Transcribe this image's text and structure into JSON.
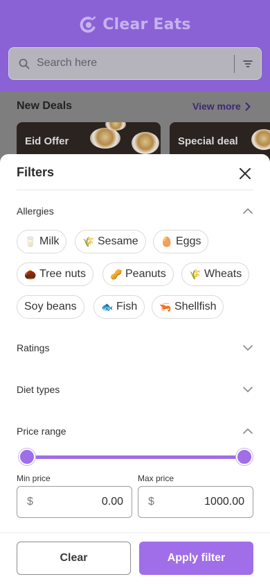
{
  "app": {
    "name": "Clear Eats"
  },
  "search": {
    "placeholder": "Search here"
  },
  "deals": {
    "title": "New Deals",
    "view_more": "View more",
    "cards": [
      {
        "label": "Eid Offer"
      },
      {
        "label": "Special deal"
      }
    ]
  },
  "filters": {
    "title": "Filters",
    "sections": {
      "allergies": {
        "label": "Allergies",
        "expanded": true
      },
      "ratings": {
        "label": "Ratings",
        "expanded": false
      },
      "diet_types": {
        "label": "Diet types",
        "expanded": false
      },
      "price_range": {
        "label": "Price range",
        "expanded": true
      }
    },
    "allergy_chips": [
      {
        "label": "Milk",
        "icon": "milk-icon",
        "emoji": "🥛"
      },
      {
        "label": "Sesame",
        "icon": "sesame-icon",
        "emoji": "🌾"
      },
      {
        "label": "Eggs",
        "icon": "egg-icon",
        "emoji": "🥚"
      },
      {
        "label": "Tree nuts",
        "icon": "tree-nut-icon",
        "emoji": "🌰"
      },
      {
        "label": "Peanuts",
        "icon": "peanut-icon",
        "emoji": "🥜"
      },
      {
        "label": "Wheats",
        "icon": "wheat-icon",
        "emoji": "🌾"
      },
      {
        "label": "Soy beans",
        "icon": "",
        "emoji": ""
      },
      {
        "label": "Fish",
        "icon": "fish-icon",
        "emoji": "🐟"
      },
      {
        "label": "Shellfish",
        "icon": "shrimp-icon",
        "emoji": "🦐"
      }
    ],
    "price": {
      "min_label": "Min price",
      "max_label": "Max price",
      "currency": "$",
      "min_value": "0.00",
      "max_value": "1000.00",
      "slider_min_fraction": 0,
      "slider_max_fraction": 1
    },
    "buttons": {
      "clear": "Clear",
      "apply": "Apply filter"
    }
  },
  "colors": {
    "accent": "#A06EE8",
    "header_dimmed": "#8A62D6",
    "text_dark": "#2B2B2B"
  }
}
